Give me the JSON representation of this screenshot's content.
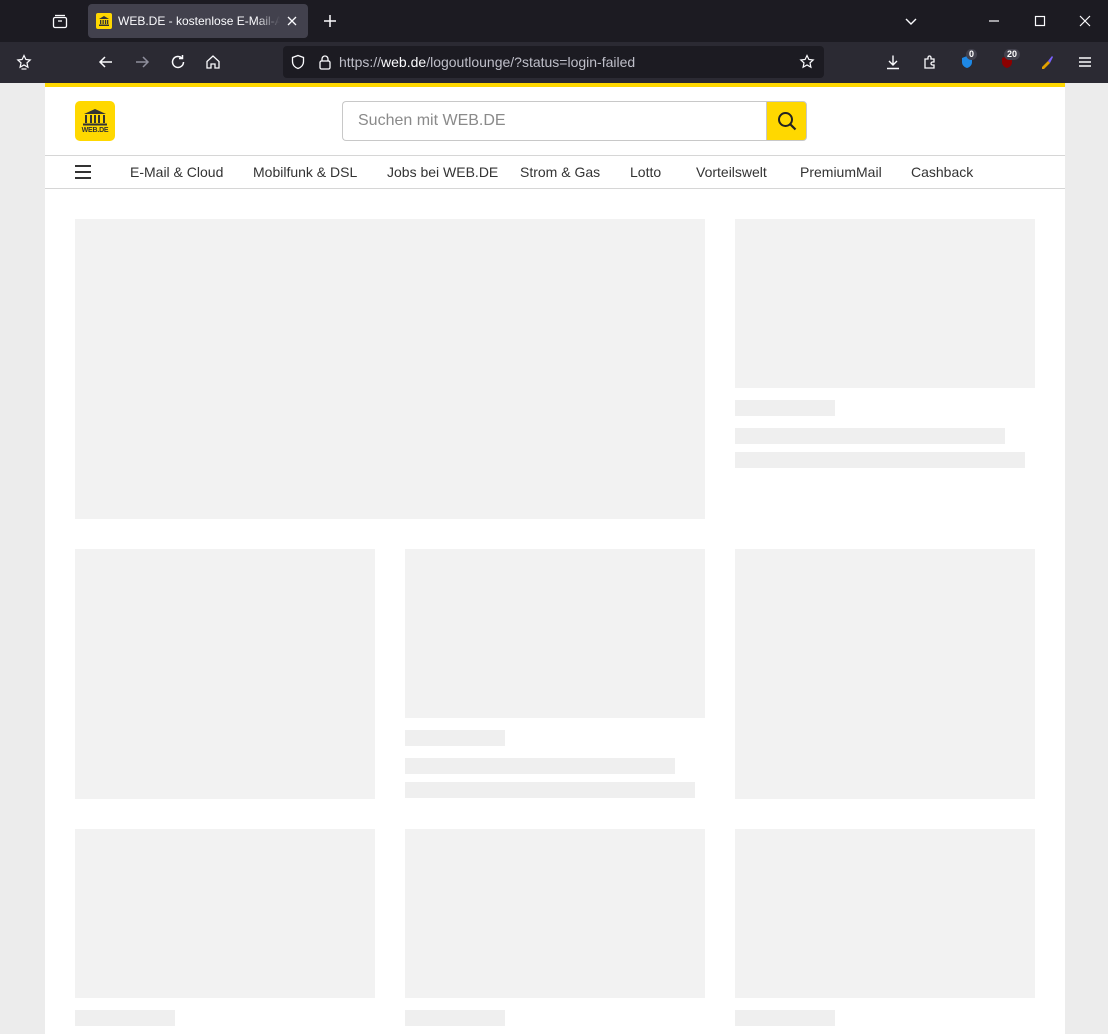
{
  "browser": {
    "tab": {
      "title": "WEB.DE - kostenlose E-Mail-Adresse"
    },
    "url": {
      "scheme": "https://",
      "host": "web.de",
      "path": "/logoutlounge/?status=login-failed"
    },
    "extension_badges": {
      "ext1": "0",
      "ext2": "20"
    }
  },
  "page": {
    "logo_text": "WEB.DE",
    "search": {
      "placeholder": "Suchen mit WEB.DE"
    },
    "nav": [
      {
        "label": "E-Mail & Cloud"
      },
      {
        "label": "Mobilfunk & DSL"
      },
      {
        "label": "Jobs bei WEB.DE"
      },
      {
        "label": "Strom & Gas"
      },
      {
        "label": "Lotto"
      },
      {
        "label": "Vorteilswelt"
      },
      {
        "label": "PremiumMail"
      },
      {
        "label": "Cashback"
      }
    ]
  },
  "colors": {
    "brand_yellow": "#ffd800",
    "chrome_dark": "#1c1b22",
    "toolbar": "#2b2a33",
    "skeleton": "#f2f2f2"
  }
}
